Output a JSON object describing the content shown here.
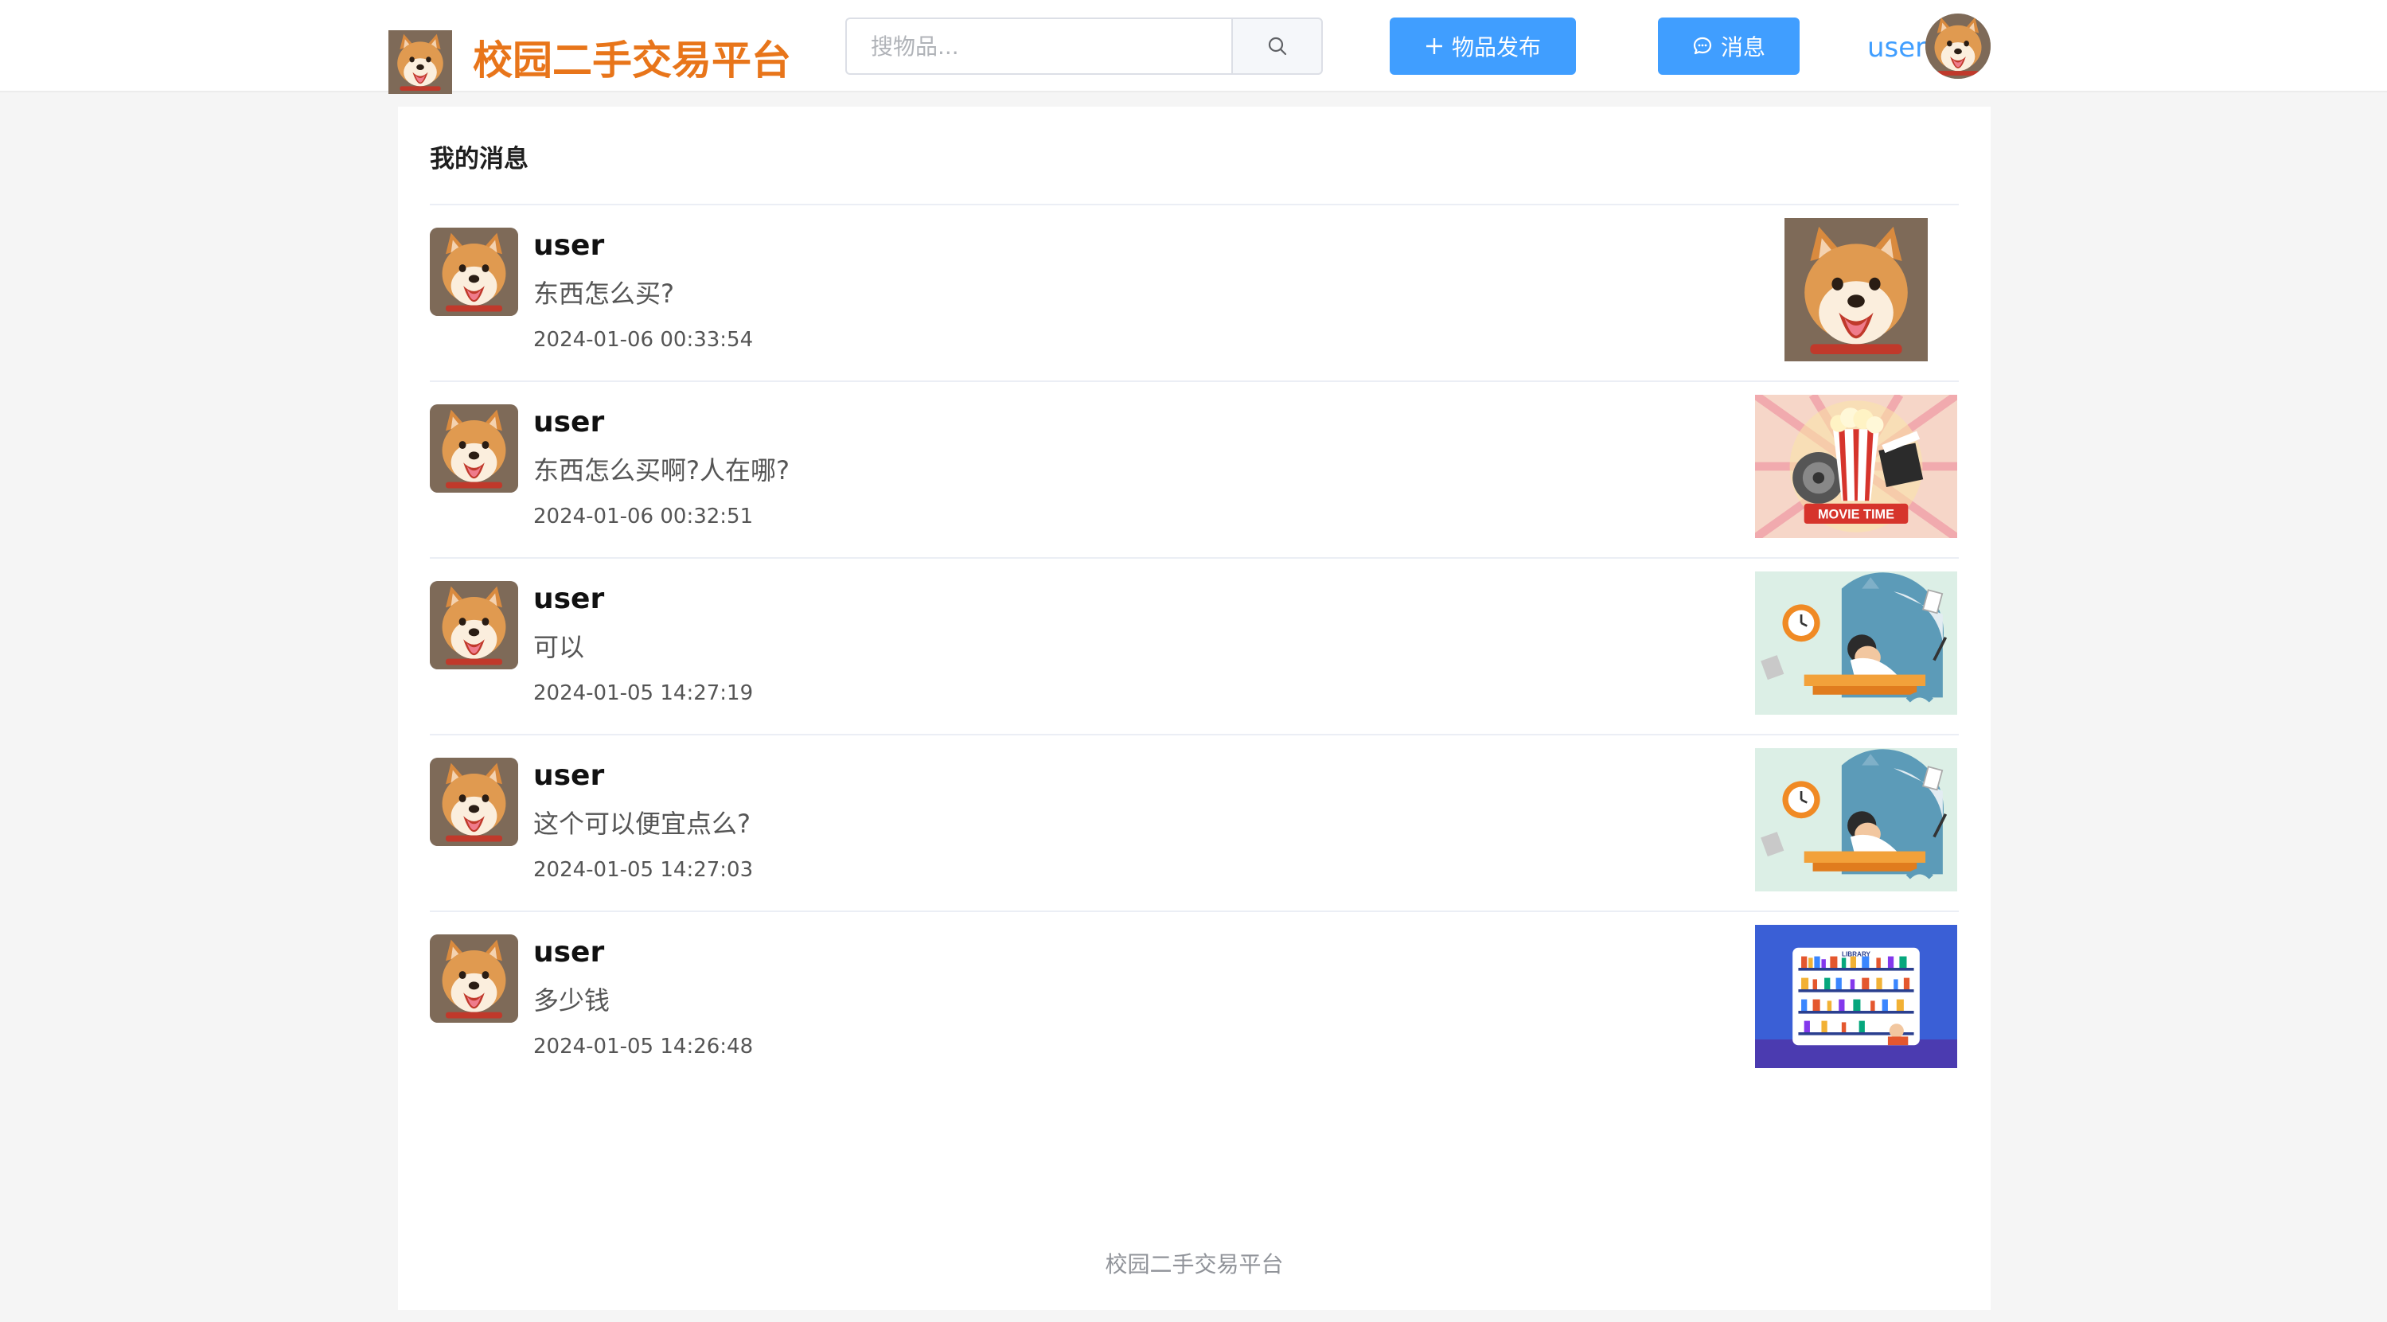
{
  "header": {
    "site_title": "校园二手交易平台",
    "search_placeholder": "搜物品...",
    "publish_label": "物品发布",
    "message_label": "消息",
    "username": "user"
  },
  "page": {
    "title": "我的消息",
    "footer": "校园二手交易平台"
  },
  "messages": [
    {
      "user": "user",
      "text": "东西怎么买?",
      "time": "2024-01-06 00:33:54",
      "thumb": "shiba-dog-photo"
    },
    {
      "user": "user",
      "text": "东西怎么买啊?人在哪?",
      "time": "2024-01-06 00:32:51",
      "thumb": "movie-time-illustration"
    },
    {
      "user": "user",
      "text": "可以",
      "time": "2024-01-05 14:27:19",
      "thumb": "studying-desk-illustration"
    },
    {
      "user": "user",
      "text": "这个可以便宜点么?",
      "time": "2024-01-05 14:27:03",
      "thumb": "studying-desk-illustration"
    },
    {
      "user": "user",
      "text": "多少钱",
      "time": "2024-01-05 14:26:48",
      "thumb": "library-illustration"
    }
  ],
  "thumb_texts": {
    "movie": "MOVIE TIME",
    "library": "LIBRARY"
  },
  "colors": {
    "brand_orange": "#e8751a",
    "primary_blue": "#409eff",
    "page_bg": "#f5f5f5"
  }
}
